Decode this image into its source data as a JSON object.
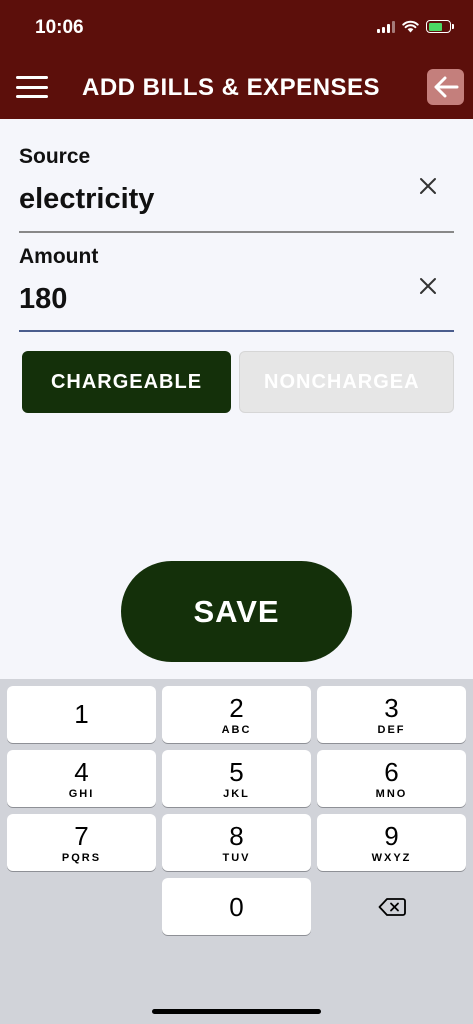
{
  "status_bar": {
    "time": "10:06"
  },
  "header": {
    "title": "ADD BILLS & EXPENSES"
  },
  "form": {
    "source": {
      "label": "Source",
      "value": "electricity"
    },
    "amount": {
      "label": "Amount",
      "value": "180"
    },
    "chargeable_label": "CHARGEABLE",
    "noncharge_label": "NONCHARGEA",
    "save_label": "SAVE"
  },
  "keyboard": {
    "keys": [
      {
        "digit": "1",
        "letters": ""
      },
      {
        "digit": "2",
        "letters": "ABC"
      },
      {
        "digit": "3",
        "letters": "DEF"
      },
      {
        "digit": "4",
        "letters": "GHI"
      },
      {
        "digit": "5",
        "letters": "JKL"
      },
      {
        "digit": "6",
        "letters": "MNO"
      },
      {
        "digit": "7",
        "letters": "PQRS"
      },
      {
        "digit": "8",
        "letters": "TUV"
      },
      {
        "digit": "9",
        "letters": "WXYZ"
      },
      {
        "digit": "0",
        "letters": ""
      }
    ]
  },
  "colors": {
    "header_bg": "#5c0f0b",
    "primary_button": "#14300a",
    "disabled_button": "#e6e6e6",
    "back_button": "#c47f7c"
  }
}
